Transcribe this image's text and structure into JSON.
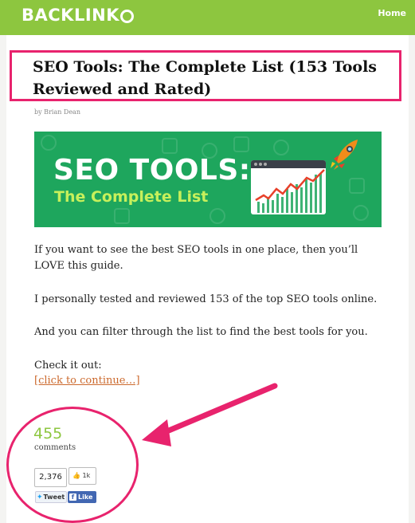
{
  "header": {
    "logo_text": "BACKLINK",
    "logo_last_letter": "O",
    "home_label": "Home",
    "bar_color": "#8dc63f"
  },
  "post": {
    "title": "SEO Tools: The Complete List (153 Tools Reviewed and Rated)",
    "byline": "by Brian Dean",
    "banner": {
      "line1": "SEO TOOLS:",
      "line2": "The Complete List",
      "bg_color": "#1ea65d"
    },
    "paragraphs": [
      "If you want to see the best SEO tools in one place, then you’ll LOVE this guide.",
      "I personally tested and reviewed 153 of the top SEO tools online.",
      "And you can filter through the list to find the best tools for you.",
      "Check it out:"
    ],
    "continue_link": "[click to continue…]"
  },
  "social": {
    "comment_count": "455",
    "comments_label": "comments",
    "tweet_count": "2,376",
    "like_count": "1k",
    "tweet_label": "Tweet",
    "like_label": "Like"
  },
  "highlight_color": "#e8236d"
}
